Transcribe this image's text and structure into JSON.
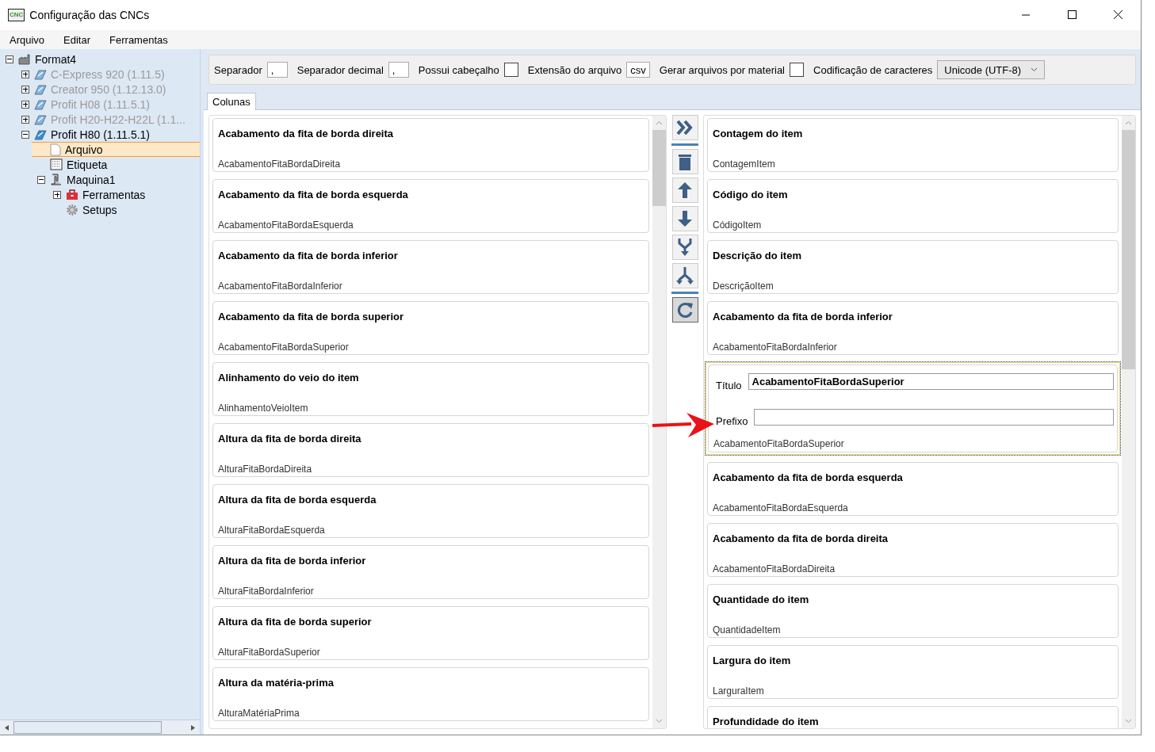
{
  "window": {
    "title": "Configuração das CNCs",
    "app_icon": "CNC"
  },
  "menu": [
    "Arquivo",
    "Editar",
    "Ferramentas"
  ],
  "tree": [
    {
      "label": "Format4",
      "kind": "factory",
      "disabled": false,
      "selected": false,
      "expanded": true,
      "children": [
        {
          "label": "C-Express 920 (1.11.5)",
          "kind": "series",
          "disabled": true,
          "selected": false,
          "expanded": false
        },
        {
          "label": "Creator 950 (1.12.13.0)",
          "kind": "series",
          "disabled": true,
          "selected": false,
          "expanded": false
        },
        {
          "label": "Profit H08 (1.11.5.1)",
          "kind": "series",
          "disabled": true,
          "selected": false,
          "expanded": false
        },
        {
          "label": "Profit  H20-H22-H22L  (1.1...",
          "kind": "series",
          "disabled": true,
          "selected": false,
          "expanded": false
        },
        {
          "label": "Profit H80 (1.11.5.1)",
          "kind": "series",
          "disabled": false,
          "selected": false,
          "expanded": true,
          "children": [
            {
              "label": "Arquivo",
              "kind": "file",
              "disabled": false,
              "selected": true
            },
            {
              "label": "Etiqueta",
              "kind": "label",
              "disabled": false,
              "selected": false
            },
            {
              "label": "Maquina1",
              "kind": "machine",
              "disabled": false,
              "selected": false,
              "expanded": true,
              "children": [
                {
                  "label": "Ferramentas",
                  "kind": "toolbox",
                  "disabled": false,
                  "selected": false,
                  "expanded": false
                },
                {
                  "label": "Setups",
                  "kind": "gear",
                  "disabled": false,
                  "selected": false
                }
              ]
            }
          ]
        }
      ]
    }
  ],
  "options": [
    {
      "kind": "text",
      "label": "Separador",
      "value": ","
    },
    {
      "kind": "text",
      "label": "Separador decimal",
      "value": ","
    },
    {
      "kind": "check",
      "label": "Possui cabeçalho",
      "checked": false
    },
    {
      "kind": "text",
      "label": "Extensão do arquivo",
      "value": "csv"
    },
    {
      "kind": "check",
      "label": "Gerar arquivos por material",
      "checked": false
    },
    {
      "kind": "select",
      "label": "Codificação de caracteres",
      "value": "Unicode (UTF-8)"
    }
  ],
  "tabs": [
    {
      "label": "Colunas",
      "selected": true
    }
  ],
  "available_columns": [
    {
      "title": "Acabamento da fita de borda direita",
      "name": "AcabamentoFitaBordaDireita"
    },
    {
      "title": "Acabamento da fita de borda esquerda",
      "name": "AcabamentoFitaBordaEsquerda"
    },
    {
      "title": "Acabamento da fita de borda inferior",
      "name": "AcabamentoFitaBordaInferior"
    },
    {
      "title": "Acabamento da fita de borda superior",
      "name": "AcabamentoFitaBordaSuperior"
    },
    {
      "title": "Alinhamento do veio do item",
      "name": "AlinhamentoVeioItem"
    },
    {
      "title": "Altura da fita de borda direita",
      "name": "AlturaFitaBordaDireita"
    },
    {
      "title": "Altura da fita de borda esquerda",
      "name": "AlturaFitaBordaEsquerda"
    },
    {
      "title": "Altura da fita de borda inferior",
      "name": "AlturaFitaBordaInferior"
    },
    {
      "title": "Altura da fita de borda superior",
      "name": "AlturaFitaBordaSuperior"
    },
    {
      "title": "Altura da matéria-prima",
      "name": "AlturaMatériaPrima"
    }
  ],
  "tool_buttons": [
    {
      "kind": "add-all",
      "pressed": false
    },
    {
      "kind": "separator"
    },
    {
      "kind": "delete",
      "pressed": false
    },
    {
      "kind": "up",
      "pressed": false
    },
    {
      "kind": "down",
      "pressed": false
    },
    {
      "kind": "merge",
      "pressed": false
    },
    {
      "kind": "split",
      "pressed": false
    },
    {
      "kind": "separator"
    },
    {
      "kind": "reset",
      "pressed": true
    }
  ],
  "selected_columns": [
    {
      "kind": "plain",
      "title": "Contagem do item",
      "name": "ContagemItem"
    },
    {
      "kind": "plain",
      "title": "Código do item",
      "name": "CódigoItem"
    },
    {
      "kind": "plain",
      "title": "Descrição do item",
      "name": "DescriçãoItem"
    },
    {
      "kind": "plain",
      "title": "Acabamento da fita de borda inferior",
      "name": "AcabamentoFitaBordaInferior"
    },
    {
      "kind": "edit",
      "focused": true,
      "title_label": "Título",
      "title_value": "AcabamentoFitaBordaSuperior",
      "prefix_label": "Prefixo",
      "name": "AcabamentoFitaBordaSuperior"
    },
    {
      "kind": "plain",
      "title": "Acabamento da fita de borda esquerda",
      "name": "AcabamentoFitaBordaEsquerda"
    },
    {
      "kind": "plain",
      "title": "Acabamento da fita de borda direita",
      "name": "AcabamentoFitaBordaDireita"
    },
    {
      "kind": "plain",
      "title": "Quantidade do item",
      "name": "QuantidadeItem"
    },
    {
      "kind": "plain",
      "title": "Largura do item",
      "name": "LarguraItem"
    },
    {
      "kind": "plain",
      "title": "Profundidade do item"
    }
  ],
  "annotation": {
    "kind": "arrow"
  }
}
